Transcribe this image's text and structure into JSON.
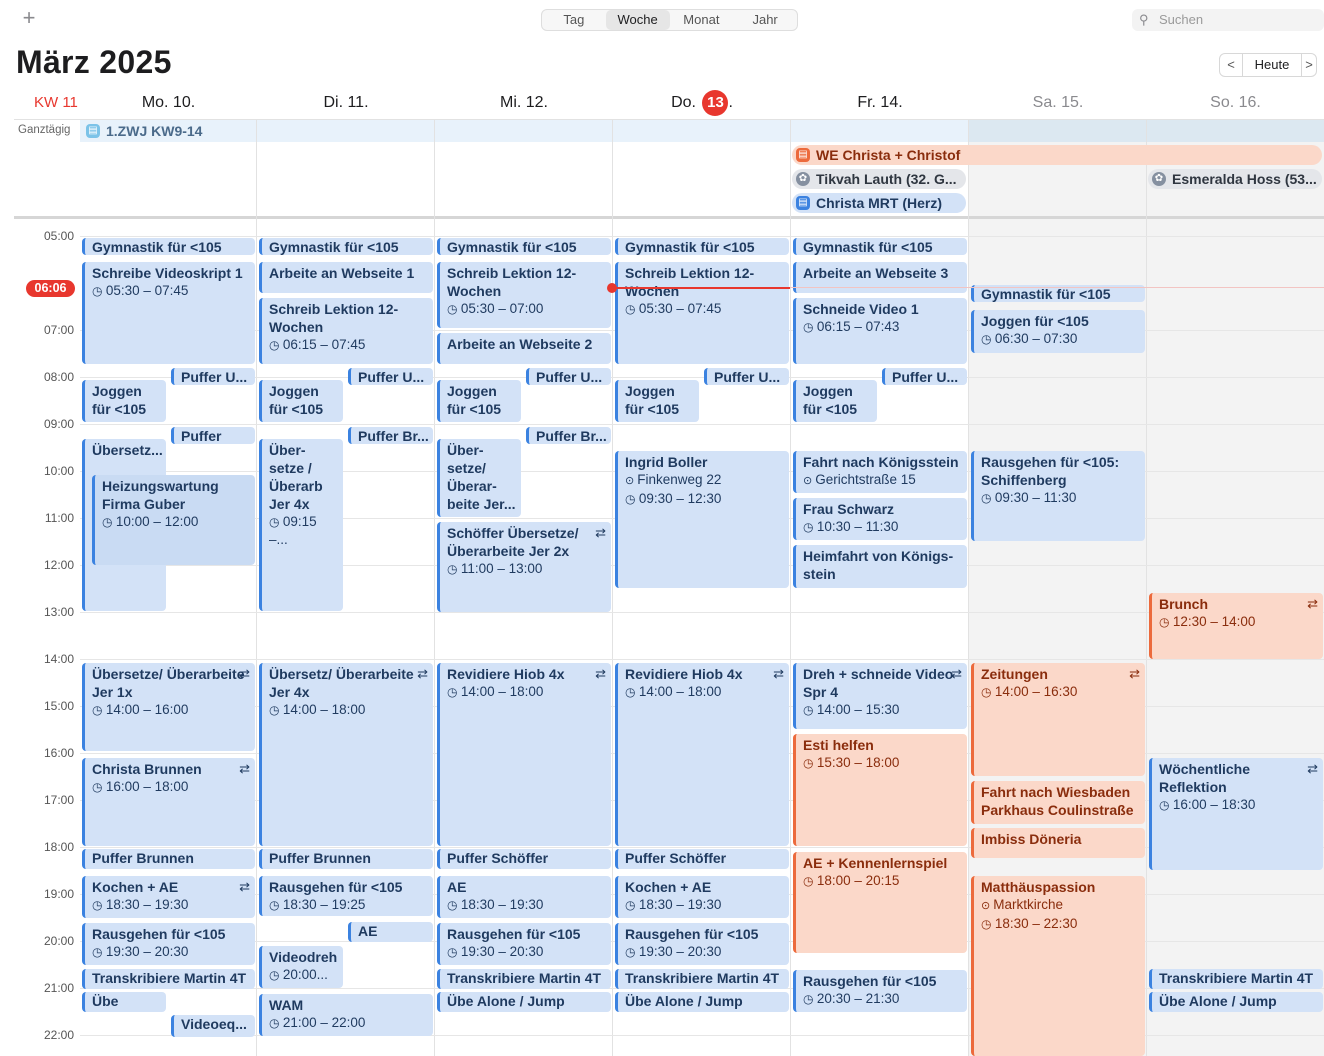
{
  "toolbar": {
    "plus": "+",
    "views": [
      "Tag",
      "Woche",
      "Monat",
      "Jahr"
    ],
    "active_view": "Woche",
    "search_placeholder": "Suchen",
    "search_icon": "magnifier-icon"
  },
  "header": {
    "title": "März 2025",
    "nav_prev": "<",
    "today": "Heute",
    "nav_next": ">",
    "week_label": "KW 11"
  },
  "days": [
    {
      "label": "Mo. 10."
    },
    {
      "label": "Di. 11."
    },
    {
      "label": "Mi. 12."
    },
    {
      "prefix": "Do.",
      "num": "13",
      "suffix": "."
    },
    {
      "label": "Fr. 14."
    },
    {
      "label": "Sa. 15."
    },
    {
      "label": "So. 16."
    }
  ],
  "allday_label": "Ganztägig",
  "allday": {
    "zwj": "1.ZWJ KW9-14",
    "we": "WE Christa + Christof",
    "tikvah": "Tikvah Lauth (32. G...",
    "mrt": "Christa MRT (Herz)",
    "esmeralda": "Esmeralda Hoss (53..."
  },
  "now_time": "06:06",
  "times": [
    "05:00",
    "07:00",
    "08:00",
    "09:00",
    "10:00",
    "11:00",
    "12:00",
    "13:00",
    "14:00",
    "15:00",
    "16:00",
    "17:00",
    "18:00",
    "19:00",
    "20:00",
    "21:00",
    "22:00"
  ],
  "colors": {
    "accent_red": "#e8372e",
    "event_blue": "#d3e2f7",
    "event_orange": "#fbd8c9"
  },
  "events": {
    "mon": {
      "gym": "Gymnastik für <105",
      "video": {
        "title": "Schreibe Videoskript 1",
        "time": "05:30 – 07:45"
      },
      "puffer1": "Puffer U...",
      "joggen": "Joggen für <105",
      "puffer2": "Puffer Br...",
      "uebersetz": "Übersetz...",
      "heiz": {
        "title": "Heizungswartung Firma Guber",
        "time": "10:00 – 12:00"
      },
      "jer": {
        "title": "Übersetze/ Überarbeite Jer 1x",
        "time": "14:00 – 16:00"
      },
      "christa": {
        "title": "Christa Brunnen",
        "time": "16:00 – 18:00"
      },
      "pufbrunnen": "Puffer Brunnen",
      "kochen": {
        "title": "Kochen + AE",
        "time": "18:30 – 19:30"
      },
      "rausgehen": {
        "title": "Rausgehen für <105",
        "time": "19:30 – 20:30"
      },
      "trans": "Transkribiere Martin 4T",
      "uebe": "Übe Alon...",
      "videoeq": "Videoeq..."
    },
    "tue": {
      "gym": "Gymnastik für <105",
      "web": "Arbeite an Webseite 1",
      "lektion": {
        "title": "Schreib Lektion 12-Wochen",
        "time": "06:15 – 07:45"
      },
      "puffer1": "Puffer U...",
      "joggen": "Joggen für <105",
      "puffer2": "Puffer Br...",
      "ueber": {
        "title": "Über- setze / Überarb Jer 4x",
        "time": "09:15 –..."
      },
      "jer": {
        "title": "Übersetz/ Überarbeite Jer 4x",
        "time": "14:00 – 18:00"
      },
      "pufbrunnen": "Puffer Brunnen",
      "rausgehen": {
        "title": "Rausgehen für <105",
        "time": "18:30 – 19:25"
      },
      "ae": "AE",
      "videodreh": {
        "title": "Videodreh",
        "time": "20:00..."
      },
      "wam": {
        "title": "WAM",
        "time": "21:00 – 22:00"
      }
    },
    "wed": {
      "gym": "Gymnastik für <105",
      "lektion": {
        "title": "Schreib Lektion 12-Wochen",
        "time": "05:30 – 07:00"
      },
      "web": "Arbeite an Webseite 2",
      "puffer1": "Puffer U...",
      "joggen": "Joggen für <105",
      "puffer2": "Puffer Br...",
      "ueber": "Über- setze/ Überar- beite Jer...",
      "schoeffer": {
        "title": "Schöffer Übersetze/ Überarbeite Jer 2x",
        "time": "11:00 – 13:00"
      },
      "hiob": {
        "title": "Revidiere Hiob 4x",
        "time": "14:00 – 18:00"
      },
      "pufschoeffer": "Puffer Schöffer",
      "ae": {
        "title": "AE",
        "time": "18:30 – 19:30"
      },
      "rausgehen": {
        "title": "Rausgehen für <105",
        "time": "19:30 – 20:30"
      },
      "trans": "Transkribiere Martin 4T",
      "uebe": "Übe Alone / Jump"
    },
    "thu": {
      "gym": "Gymnastik für <105",
      "lektion": {
        "title": "Schreib Lektion 12-Wochen",
        "time": "05:30 – 07:45"
      },
      "puffer1": "Puffer U...",
      "joggen": "Joggen für <105",
      "ingrid": {
        "title": "Ingrid Boller",
        "loc": "Finkenweg 22",
        "time": "09:30 – 12:30"
      },
      "hiob": {
        "title": "Revidiere Hiob 4x",
        "time": "14:00 – 18:00"
      },
      "pufschoeffer": "Puffer Schöffer",
      "kochen": {
        "title": "Kochen + AE",
        "time": "18:30 – 19:30"
      },
      "rausgehen": {
        "title": "Rausgehen für <105",
        "time": "19:30 – 20:30"
      },
      "trans": "Transkribiere Martin 4T",
      "uebe": "Übe Alone / Jump"
    },
    "fri": {
      "gym": "Gymnastik für <105",
      "web": "Arbeite an Webseite 3",
      "video": {
        "title": "Schneide Video 1",
        "time": "06:15 – 07:43"
      },
      "puffer1": "Puffer U...",
      "joggen": "Joggen für <105",
      "fahrt": {
        "title": "Fahrt nach Königsstein",
        "loc": "Gerichtstraße 15"
      },
      "frau": {
        "title": "Frau Schwarz",
        "time": "10:30 – 11:30"
      },
      "heim": "Heimfahrt von Königs- stein",
      "dreh": {
        "title": "Dreh + schneide Video Spr 4",
        "time": "14:00 – 15:30"
      },
      "esti": {
        "title": "Esti helfen",
        "time": "15:30 – 18:00"
      },
      "kennen": {
        "title": "AE + Kennenlernspiel",
        "time": "18:00 – 20:15"
      },
      "rausgehen": {
        "title": "Rausgehen für <105",
        "time": "20:30 – 21:30"
      }
    },
    "sat": {
      "gym": "Gymnastik für <105",
      "joggen": {
        "title": "Joggen für <105",
        "time": "06:30 – 07:30"
      },
      "schiff": {
        "title": "Rausgehen für <105: Schiffenberg",
        "time": "09:30 – 11:30"
      },
      "zeitungen": {
        "title": "Zeitungen",
        "time": "14:00 – 16:30"
      },
      "wiesbaden": "Fahrt nach Wiesbaden Parkhaus Coulinstraße",
      "imbiss": "Imbiss Döneria",
      "matth": {
        "title": "Matthäuspassion",
        "loc": "Marktkirche",
        "time": "18:30 – 22:30"
      }
    },
    "sun": {
      "brunch": {
        "title": "Brunch",
        "time": "12:30 – 14:00"
      },
      "reflektion": {
        "title": "Wöchentliche Reflektion",
        "time": "16:00 – 18:30"
      },
      "trans": "Transkribiere Martin 4T",
      "uebe": "Übe Alone / Jump"
    }
  }
}
